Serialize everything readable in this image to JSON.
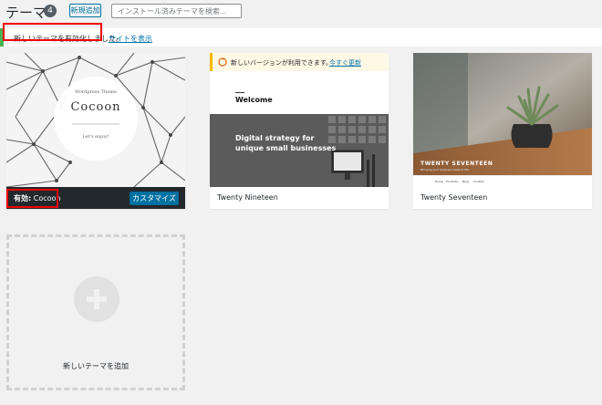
{
  "header": {
    "title": "テーマ",
    "count": "4",
    "add_new_label": "新規追加",
    "search_placeholder": "インストール済みテーマを検索..."
  },
  "notice": {
    "text": "新しいテーマを有効化しました。",
    "link": "サイトを表示"
  },
  "themes": [
    {
      "name": "Cocoon",
      "active_prefix": "有効:",
      "customize_label": "カスタマイズ",
      "screenshot": {
        "tagline": "Wordpress Theme",
        "title": "Cocoon",
        "subtitle": "Let's enjoy!"
      }
    },
    {
      "name": "Twenty Nineteen",
      "update_text": "新しいバージョンが利用できます。",
      "update_link": "今すぐ更新",
      "screenshot": {
        "heading": "Welcome",
        "banner_line1": "Digital strategy for",
        "banner_line2": "unique small businesses"
      }
    },
    {
      "name": "Twenty Seventeen",
      "screenshot": {
        "title": "TWENTY SEVENTEEN",
        "tagline": "Bringing your business ideas to life",
        "menu": [
          "Home",
          "Products",
          "Blog",
          "Contact"
        ]
      }
    }
  ],
  "add_new_theme": {
    "label": "新しいテーマを追加"
  },
  "colors": {
    "notice_success": "#46b450",
    "highlight": "#ee0000",
    "primary": "#0071a1",
    "update_warning": "#ffb900"
  }
}
